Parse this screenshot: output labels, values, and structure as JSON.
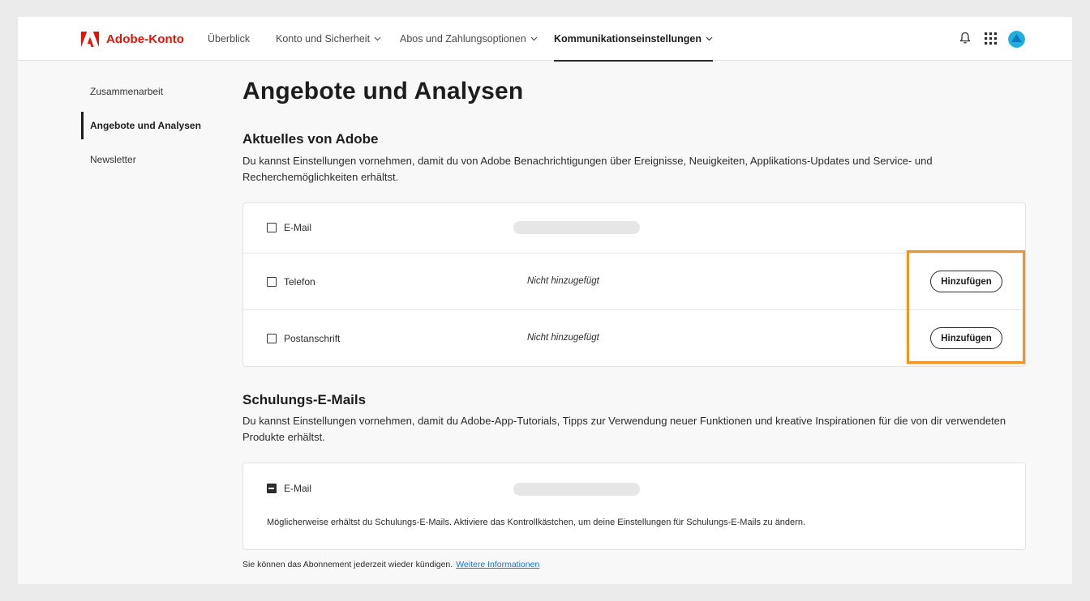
{
  "header": {
    "brand": "Adobe-Konto",
    "brand_color": "#eb1000",
    "nav": [
      {
        "label": "Überblick",
        "dropdown": false,
        "active": false
      },
      {
        "label": "Konto und Sicherheit",
        "dropdown": true,
        "active": false
      },
      {
        "label": "Abos und Zahlungsoptionen",
        "dropdown": true,
        "active": false
      },
      {
        "label": "Kommunikationseinstellungen",
        "dropdown": true,
        "active": true
      }
    ],
    "icons": [
      "bell-icon",
      "app-grid-icon",
      "avatar"
    ]
  },
  "sidebar": {
    "items": [
      {
        "label": "Zusammenarbeit",
        "active": false
      },
      {
        "label": "Angebote und Analysen",
        "active": true
      },
      {
        "label": "Newsletter",
        "active": false
      }
    ]
  },
  "main": {
    "title": "Angebote und Analysen",
    "section1": {
      "heading": "Aktuelles von Adobe",
      "description": "Du kannst Einstellungen vornehmen, damit du von Adobe Benachrichtigungen über Ereignisse, Neuigkeiten, Applikations-Updates und Service- und Recherchemöglichkeiten erhältst.",
      "rows": [
        {
          "label": "E-Mail",
          "checked": false
        },
        {
          "label": "Telefon",
          "checked": false,
          "status": "Nicht hinzugefügt",
          "button": "Hinzufügen"
        },
        {
          "label": "Postanschrift",
          "checked": false,
          "status": "Nicht hinzugefügt",
          "button": "Hinzufügen"
        }
      ]
    },
    "section2": {
      "heading": "Schulungs-E-Mails",
      "description": "Du kannst Einstellungen vornehmen, damit du Adobe-App-Tutorials, Tipps zur Verwendung neuer Funktionen und kreative Inspirationen für die von dir verwendeten Produkte erhältst.",
      "row": {
        "label": "E-Mail",
        "state": "indeterminate"
      },
      "note": "Möglicherweise erhältst du Schulungs-E-Mails. Aktiviere das Kontrollkästchen, um deine Einstellungen für Schulungs-E-Mails zu ändern."
    },
    "footer": {
      "text": "Sie können das Abonnement jederzeit wieder kündigen.",
      "link": "Weitere Informationen"
    }
  },
  "highlight_color": "#f29423"
}
